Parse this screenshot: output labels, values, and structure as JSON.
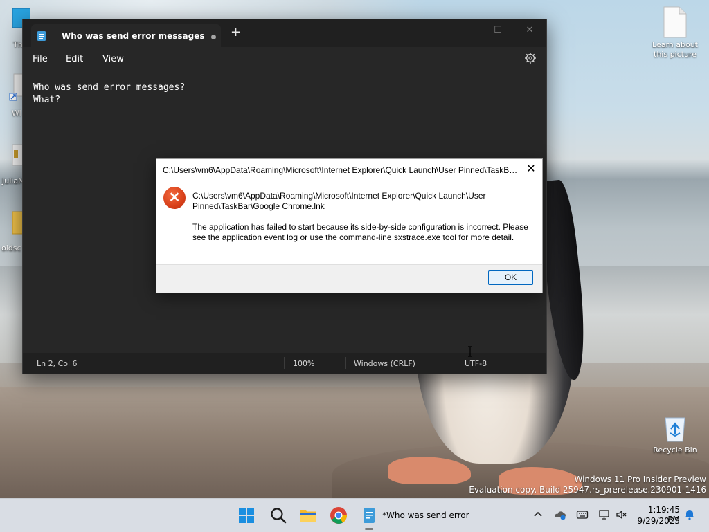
{
  "desktop": {
    "icons": [
      {
        "label": "Th"
      },
      {
        "label": "Wi"
      },
      {
        "label": "JuliaM"
      },
      {
        "label": "oldsc"
      },
      {
        "label": "Learn about this picture"
      },
      {
        "label": "Recycle Bin"
      }
    ],
    "watermark": {
      "line1": "Windows 11 Pro Insider Preview",
      "line2": "Evaluation copy. Build 25947.rs_prerelease.230901-1416"
    }
  },
  "notepad": {
    "tab_title": "Who was send error messages",
    "new_tab": "+",
    "window_buttons": {
      "minimize": "—",
      "maximize": "☐",
      "close": "✕"
    },
    "menu": [
      "File",
      "Edit",
      "View"
    ],
    "content_lines": [
      "Who was send error messages?",
      "What?"
    ],
    "status": {
      "position": "Ln 2, Col 6",
      "zoom": "100%",
      "line_ending": "Windows (CRLF)",
      "encoding": "UTF-8"
    }
  },
  "dialog": {
    "title": "C:\\Users\\vm6\\AppData\\Roaming\\Microsoft\\Internet Explorer\\Quick Launch\\User Pinned\\TaskBa...",
    "close": "✕",
    "icon": "error-icon",
    "path_text": "C:\\Users\\vm6\\AppData\\Roaming\\Microsoft\\Internet Explorer\\Quick Launch\\User Pinned\\TaskBar\\Google Chrome.lnk",
    "message": "The application has failed to start because its side-by-side configuration is incorrect. Please see the application event log or use the command-line sxstrace.exe tool for more detail.",
    "ok_label": "OK"
  },
  "taskbar": {
    "apps": [
      "start-icon",
      "search-icon",
      "file-explorer-icon",
      "chrome-icon",
      "notepad-icon"
    ],
    "notepad_label": "*Who was send error m",
    "clock": {
      "time": "1:19:45 PM",
      "date": "9/29/2023"
    }
  },
  "colors": {
    "notepad_bg": "#272727",
    "titlebar_bg": "#202020",
    "error_red": "#d8401a",
    "ok_border": "#0067c0",
    "taskbar_bg": "#d9dde4"
  }
}
